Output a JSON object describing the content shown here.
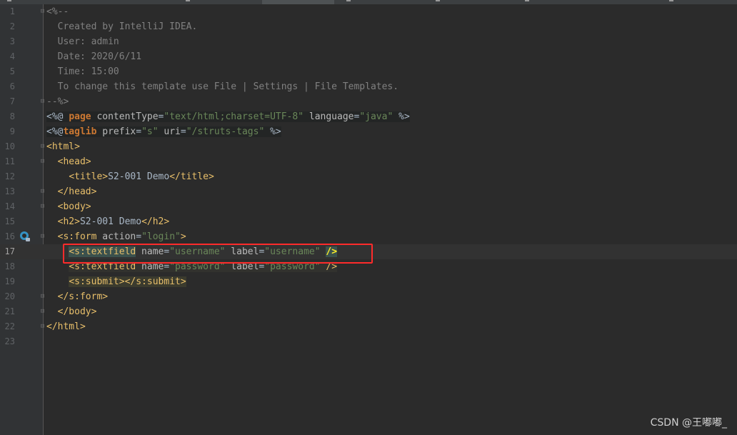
{
  "editor": {
    "lines": [
      {
        "num": "1",
        "segments": [
          {
            "t": "<%--",
            "c": "cmt"
          }
        ]
      },
      {
        "num": "2",
        "segments": [
          {
            "t": "  Created by IntelliJ IDEA.",
            "c": "cmt"
          }
        ]
      },
      {
        "num": "3",
        "segments": [
          {
            "t": "  User: admin",
            "c": "cmt"
          }
        ]
      },
      {
        "num": "4",
        "segments": [
          {
            "t": "  Date: 2020/6/11",
            "c": "cmt"
          }
        ]
      },
      {
        "num": "5",
        "segments": [
          {
            "t": "  Time: 15:00",
            "c": "cmt"
          }
        ]
      },
      {
        "num": "6",
        "segments": [
          {
            "t": "  To change this template use File | Settings | File Templates.",
            "c": "cmt"
          }
        ]
      },
      {
        "num": "7",
        "segments": [
          {
            "t": "--%>",
            "c": "cmt"
          }
        ]
      },
      {
        "num": "8",
        "segments": [
          {
            "t": "<%@ ",
            "c": "punct jsp-bg"
          },
          {
            "t": "page ",
            "c": "kw jsp-bg"
          },
          {
            "t": "contentType",
            "c": "attr jsp-bg"
          },
          {
            "t": "=",
            "c": "punct jsp-bg"
          },
          {
            "t": "\"text/html;charset=UTF-8\"",
            "c": "val jsp-bg"
          },
          {
            "t": " language",
            "c": "attr jsp-bg"
          },
          {
            "t": "=",
            "c": "punct jsp-bg"
          },
          {
            "t": "\"java\"",
            "c": "val jsp-bg"
          },
          {
            "t": " %>",
            "c": "punct jsp-bg"
          }
        ]
      },
      {
        "num": "9",
        "segments": [
          {
            "t": "<%@",
            "c": "punct jsp-bg"
          },
          {
            "t": "taglib ",
            "c": "kw jsp-bg"
          },
          {
            "t": "prefix",
            "c": "attr jsp-bg"
          },
          {
            "t": "=",
            "c": "punct jsp-bg"
          },
          {
            "t": "\"s\"",
            "c": "val jsp-bg"
          },
          {
            "t": " uri",
            "c": "attr jsp-bg"
          },
          {
            "t": "=",
            "c": "punct jsp-bg"
          },
          {
            "t": "\"/struts-tags\"",
            "c": "val jsp-bg"
          },
          {
            "t": " %>",
            "c": "punct jsp-bg"
          }
        ]
      },
      {
        "num": "10",
        "segments": [
          {
            "t": "<html>",
            "c": "tag"
          }
        ]
      },
      {
        "num": "11",
        "segments": [
          {
            "t": "  "
          },
          {
            "t": "<head>",
            "c": "tag"
          }
        ]
      },
      {
        "num": "12",
        "segments": [
          {
            "t": "    "
          },
          {
            "t": "<title>",
            "c": "tag"
          },
          {
            "t": "S2-001 Demo",
            "c": "punct"
          },
          {
            "t": "</title>",
            "c": "tag"
          }
        ]
      },
      {
        "num": "13",
        "segments": [
          {
            "t": "  "
          },
          {
            "t": "</head>",
            "c": "tag"
          }
        ]
      },
      {
        "num": "14",
        "segments": [
          {
            "t": "  "
          },
          {
            "t": "<body>",
            "c": "tag"
          }
        ]
      },
      {
        "num": "15",
        "segments": [
          {
            "t": "  "
          },
          {
            "t": "<h2>",
            "c": "tag"
          },
          {
            "t": "S2-001 Demo",
            "c": "punct"
          },
          {
            "t": "</h2>",
            "c": "tag"
          }
        ]
      },
      {
        "num": "16",
        "segments": [
          {
            "t": "  "
          },
          {
            "t": "<s:form ",
            "c": "tag"
          },
          {
            "t": "action",
            "c": "attr"
          },
          {
            "t": "=",
            "c": "punct"
          },
          {
            "t": "\"login\"",
            "c": "val"
          },
          {
            "t": ">",
            "c": "tag"
          }
        ]
      },
      {
        "num": "17",
        "segments": [
          {
            "t": "    "
          },
          {
            "t": "<s:textfield",
            "c": "hl-tag"
          },
          {
            "t": " name",
            "c": "attr"
          },
          {
            "t": "=",
            "c": "punct"
          },
          {
            "t": "\"username\"",
            "c": "val"
          },
          {
            "t": " label",
            "c": "attr"
          },
          {
            "t": "=",
            "c": "punct"
          },
          {
            "t": "\"username\"",
            "c": "val"
          },
          {
            "t": " "
          },
          {
            "t": "/>",
            "c": "hl-close"
          }
        ]
      },
      {
        "num": "18",
        "segments": [
          {
            "t": "    "
          },
          {
            "t": "<s:textfield",
            "c": "tag hl-bg"
          },
          {
            "t": " name",
            "c": "attr hl-bg"
          },
          {
            "t": "=",
            "c": "punct hl-bg"
          },
          {
            "t": "\"password\"",
            "c": "val hl-bg"
          },
          {
            "t": " label",
            "c": "attr hl-bg"
          },
          {
            "t": "=",
            "c": "punct hl-bg"
          },
          {
            "t": "\"password\"",
            "c": "val hl-bg"
          },
          {
            "t": " />",
            "c": "tag hl-bg"
          }
        ]
      },
      {
        "num": "19",
        "segments": [
          {
            "t": "    "
          },
          {
            "t": "<s:submit></s:submit>",
            "c": "tag submit-bg"
          }
        ]
      },
      {
        "num": "20",
        "segments": [
          {
            "t": "  "
          },
          {
            "t": "</s:form>",
            "c": "tag"
          }
        ]
      },
      {
        "num": "21",
        "segments": [
          {
            "t": "  "
          },
          {
            "t": "</body>",
            "c": "tag"
          }
        ]
      },
      {
        "num": "22",
        "segments": [
          {
            "t": "</html>",
            "c": "tag"
          }
        ]
      },
      {
        "num": "23",
        "segments": []
      }
    ],
    "active_line": "17",
    "gutter_icon": "bean-icon"
  },
  "watermark": "CSDN @王嘟嘟_"
}
